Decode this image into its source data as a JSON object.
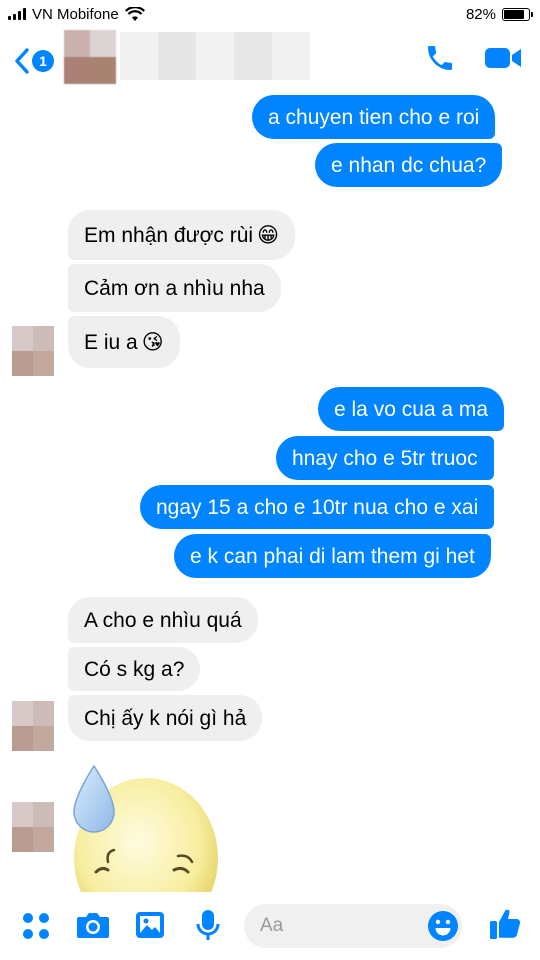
{
  "status_bar": {
    "carrier": "VN Mobifone",
    "battery_percent": "82%",
    "battery_level": 0.82
  },
  "header": {
    "unread_count": "1",
    "icons": [
      "back-chevron-icon",
      "phone-icon",
      "video-camera-icon"
    ]
  },
  "messages": [
    {
      "side": "out",
      "text": "a chuyen tien cho e roi"
    },
    {
      "side": "out",
      "text": "e nhan dc chua?"
    },
    {
      "side": "in",
      "text": "Em nhận được rùi",
      "emoji": "😁"
    },
    {
      "side": "in",
      "text": "Cảm ơn a nhìu nha"
    },
    {
      "side": "in",
      "text": "E iu a",
      "emoji": "😘"
    },
    {
      "side": "out",
      "text": "e la vo cua a ma"
    },
    {
      "side": "out",
      "text": "hnay cho e 5tr truoc"
    },
    {
      "side": "out",
      "text": "ngay 15 a cho e 10tr nua cho e xai"
    },
    {
      "side": "out",
      "text": "e k can phai di lam them gi het"
    },
    {
      "side": "in",
      "text": "A cho e nhìu quá"
    },
    {
      "side": "in",
      "text": "Có s kg a?"
    },
    {
      "side": "in",
      "text": "Chị ấy k nói gì hả"
    }
  ],
  "composer": {
    "placeholder": "Aa",
    "icons": [
      "apps-grid-icon",
      "camera-icon",
      "gallery-icon",
      "microphone-icon",
      "emoji-icon",
      "thumbs-up-icon"
    ]
  },
  "colors": {
    "accent": "#0084ff",
    "incoming_bubble": "#efefef"
  }
}
